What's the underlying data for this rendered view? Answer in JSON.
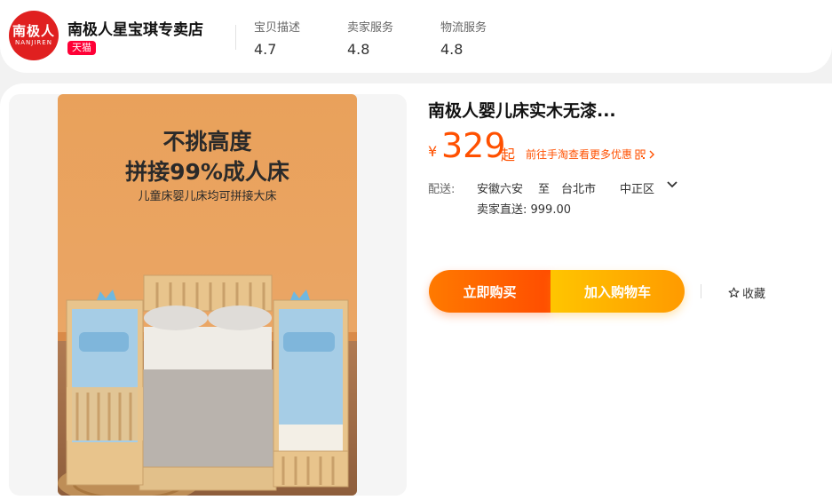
{
  "shop": {
    "logo_text": "南极人",
    "logo_subtext": "NANJIREN",
    "name": "南极人星宝琪专卖店",
    "badge": "天猫"
  },
  "scores": [
    {
      "label": "宝贝描述",
      "value": "4.7"
    },
    {
      "label": "卖家服务",
      "value": "4.8"
    },
    {
      "label": "物流服务",
      "value": "4.8"
    }
  ],
  "product": {
    "image_headline_1": "不挑高度",
    "image_headline_2": "拼接99%成人床",
    "image_subline": "儿童床婴儿床均可拼接大床",
    "title": "南极人婴儿床实木无漆...",
    "currency": "¥",
    "price": "329",
    "price_suffix": "起",
    "promo_link": "前往手淘查看更多优惠"
  },
  "shipping": {
    "label": "配送:",
    "from": "安徽六安",
    "to_word": "至",
    "city": "台北市",
    "district": "中正区",
    "seller_ship": "卖家直送: 999.00"
  },
  "actions": {
    "buy_now": "立即购买",
    "add_to_cart": "加入购物车",
    "favorite": "收藏"
  },
  "colors": {
    "accent": "#ff5000",
    "tmall": "#ff0036",
    "logo": "#e02020"
  }
}
